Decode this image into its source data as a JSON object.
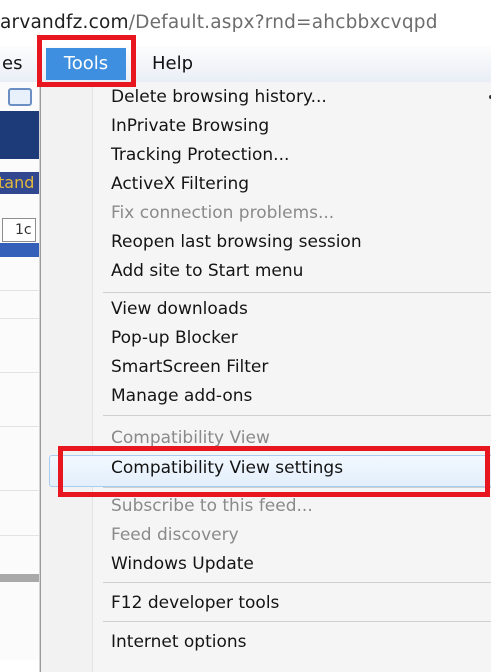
{
  "address_bar": {
    "host_text": "arvandfz.com",
    "path_text": "/Default.aspx?rnd=ahcbbxcvqpd"
  },
  "menubar": {
    "left_cut_label": "es",
    "tools_label": "Tools",
    "help_label": "Help"
  },
  "background_page": {
    "highlighted_text": "tand",
    "field_text": "1c"
  },
  "tools_menu": {
    "items": [
      {
        "label": "Delete browsing history...",
        "enabled": true
      },
      {
        "label": "InPrivate Browsing",
        "enabled": true
      },
      {
        "label": "Tracking Protection...",
        "enabled": true
      },
      {
        "label": "ActiveX Filtering",
        "enabled": true
      },
      {
        "label": "Fix connection problems...",
        "enabled": false
      },
      {
        "label": "Reopen last browsing session",
        "enabled": true
      },
      {
        "label": "Add site to Start menu",
        "enabled": true
      },
      {
        "label": "View downloads",
        "enabled": true
      },
      {
        "label": "Pop-up Blocker",
        "enabled": true
      },
      {
        "label": "SmartScreen Filter",
        "enabled": true
      },
      {
        "label": "Manage add-ons",
        "enabled": true
      },
      {
        "label": "Compatibility View",
        "enabled": false
      },
      {
        "label": "Compatibility View settings",
        "enabled": true
      },
      {
        "label": "Subscribe to this feed...",
        "enabled": false
      },
      {
        "label": "Feed discovery",
        "enabled": false
      },
      {
        "label": "Windows Update",
        "enabled": true
      },
      {
        "label": "F12 developer tools",
        "enabled": true
      },
      {
        "label": "Internet options",
        "enabled": true
      }
    ]
  },
  "colors": {
    "highlight_box": "#e8161e",
    "tools_active": "#3e8fe0"
  }
}
